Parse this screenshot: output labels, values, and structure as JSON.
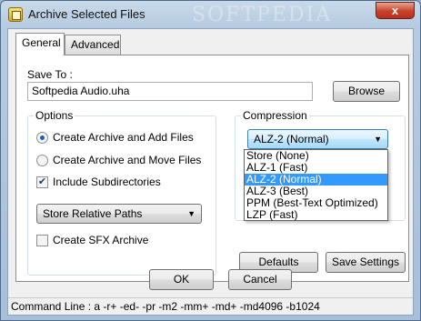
{
  "window": {
    "title": "Archive Selected Files",
    "watermark": "SOFTPEDIA",
    "close_icon": "close-icon",
    "close_glyph": "x"
  },
  "tabs": [
    {
      "label": "General",
      "active": true
    },
    {
      "label": "Advanced",
      "active": false
    }
  ],
  "save_to": {
    "label": "Save To :",
    "value": "Softpedia Audio.uha",
    "browse_label": "Browse"
  },
  "options": {
    "title": "Options",
    "radios": [
      {
        "label": "Create Archive and Add Files",
        "selected": true
      },
      {
        "label": "Create Archive and Move Files",
        "selected": false
      }
    ],
    "include_subdirectories": {
      "label": "Include Subdirectories",
      "checked": true
    },
    "paths_select": {
      "value": "Store Relative Paths"
    },
    "create_sfx": {
      "label": "Create SFX Archive",
      "checked": false
    }
  },
  "compression": {
    "title": "Compression",
    "selected": "ALZ-2 (Normal)",
    "options": [
      "Store (None)",
      "ALZ-1 (Fast)",
      "ALZ-2 (Normal)",
      "ALZ-3 (Best)",
      "PPM (Best-Text Optimized)",
      "LZP (Fast)"
    ],
    "highlighted_index": 2
  },
  "buttons": {
    "defaults": "Defaults",
    "save_settings": "Save Settings",
    "ok": "OK",
    "cancel": "Cancel"
  },
  "status_bar": {
    "command_line": "Command Line : a -r+ -ed- -pr -m2 -mm+ -md+ -md4096 -b1024"
  },
  "colors": {
    "highlight": "#3399ff",
    "close_button": "#c8412a"
  }
}
